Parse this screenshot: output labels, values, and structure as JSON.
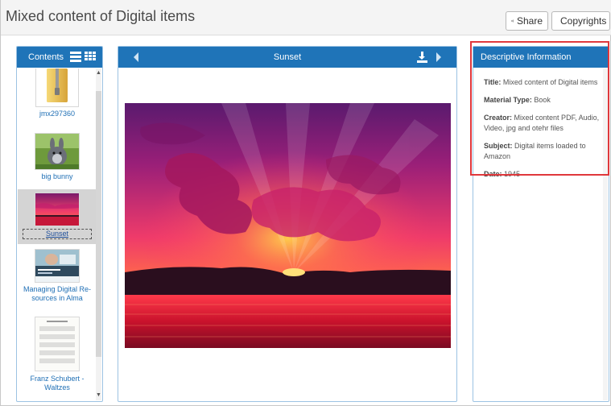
{
  "header": {
    "title": "Mixed content of Digital items",
    "share_label": "Share",
    "copyrights_label": "Copyrights"
  },
  "contents": {
    "title": "Contents",
    "items": [
      {
        "label": "jmx297360",
        "kind": "folder-zip",
        "selected": false
      },
      {
        "label": "big bunny",
        "kind": "video",
        "selected": false
      },
      {
        "label": "Sunset",
        "kind": "image",
        "selected": true
      },
      {
        "label": "Managing Digital Re- sources in Alma",
        "kind": "presentation",
        "selected": false
      },
      {
        "label": "Franz Schubert - Waltzes",
        "kind": "sheet-music",
        "selected": false
      }
    ]
  },
  "viewer": {
    "title": "Sunset",
    "prev_icon": "chevron-left-icon",
    "next_icon": "chevron-right-icon",
    "download_icon": "download-icon"
  },
  "info": {
    "title": "Descriptive Information",
    "fields": [
      {
        "label": "Title:",
        "value": "Mixed content of Digital items"
      },
      {
        "label": "Material Type:",
        "value": "Book"
      },
      {
        "label": "Creator:",
        "value": "Mixed content PDF, Audio, Video, jpg and otehr files"
      },
      {
        "label": "Subject:",
        "value": "Digital items loaded to Amazon"
      },
      {
        "label": "Date:",
        "value": "1945"
      }
    ]
  },
  "colors": {
    "panel_header": "#1f74b8",
    "highlight": "#e0383c",
    "link": "#1f6fb5"
  }
}
